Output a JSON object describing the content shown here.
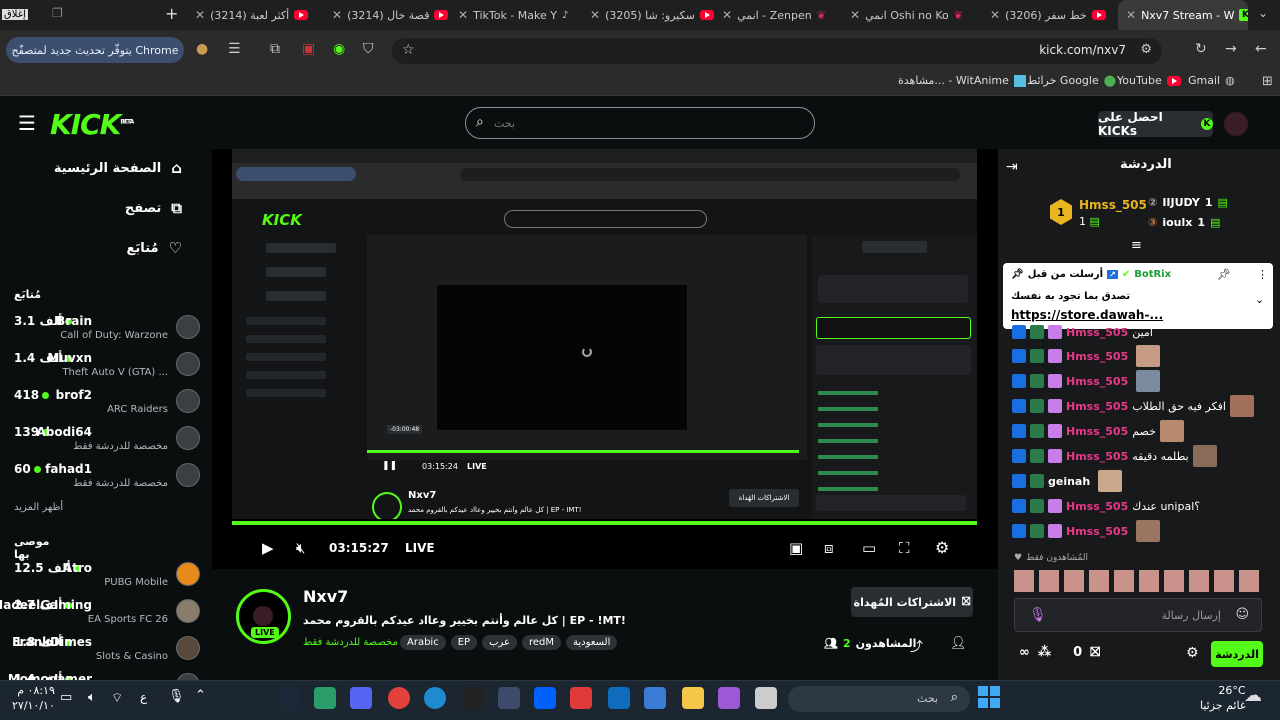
{
  "browser": {
    "tabs": [
      {
        "label": "أكثر لعبة (3214)",
        "icon": "youtube-icon"
      },
      {
        "label": "قصة خال (3214)",
        "icon": "youtube-icon"
      },
      {
        "label": "TikTok - Make Y",
        "icon": "tiktok-icon"
      },
      {
        "label": "سكيرو: شا (3205)",
        "icon": "youtube-icon"
      },
      {
        "label": "انمي - Zenpen",
        "icon": "witanime-icon"
      },
      {
        "label": "انمي Oshi no Ko",
        "icon": "witanime-icon"
      },
      {
        "label": "خط سفر (3206)",
        "icon": "youtube-icon"
      },
      {
        "label": "Nxv7 Stream - W",
        "icon": "kick-icon"
      }
    ],
    "close_button_label": "إغلاق",
    "url": "kick.com/nxv7",
    "update_label": "يتوفّر تحديث جديد لمتصفّح Chrome",
    "bookmarks": [
      {
        "label": "Gmail",
        "icon": "gmail-icon"
      },
      {
        "label": "YouTube",
        "icon": "youtube-icon"
      },
      {
        "label": "خرائط Google",
        "icon": "maps-icon"
      },
      {
        "label": "مشاهدة... - WitAnime",
        "icon": "witanime-icon"
      }
    ]
  },
  "kick": {
    "logo": "KICK",
    "beta": "BETA",
    "search_placeholder": "بحث",
    "get_kicks_label": "احصل على KICKs"
  },
  "sidebar": {
    "nav": [
      {
        "label": "الصفحة الرئيسية",
        "icon": "home-icon"
      },
      {
        "label": "تصفح",
        "icon": "browse-icon"
      },
      {
        "label": "مُتابَع",
        "icon": "heart-icon"
      }
    ],
    "following_title": "مُتابَع",
    "following": [
      {
        "name": "Brain",
        "sub": "Call of Duty: Warzone",
        "count": "3.1 ألف"
      },
      {
        "name": "Muvxn",
        "sub": "Theft Auto V (GTA) ...",
        "count": "1.4 ألف"
      },
      {
        "name": "brof2",
        "sub": "ARC Raiders",
        "count": "418"
      },
      {
        "name": "Abodi64",
        "sub": "مخصصة للدردشة فقط",
        "count": "139"
      },
      {
        "name": "fahad1",
        "sub": "مخصصة للدردشة فقط",
        "count": "60"
      }
    ],
    "show_more": "أظهر المزيد",
    "recommended_title": "موصى بها",
    "recommended": [
      {
        "name": "Atro",
        "sub": "PUBG Mobile",
        "count": "12.5 ألف"
      },
      {
        "name": "HadeelGaming",
        "sub": "EA Sports FC 26",
        "count": "2.7 ألف"
      },
      {
        "name": "FrankDimes",
        "sub": "Slots & Casino",
        "count": "1.8 ألف"
      },
      {
        "name": "Momogamer",
        "sub": "",
        "count": "1.4 ألف"
      }
    ]
  },
  "player": {
    "elapsed": "03:15:27",
    "live_label": "LIVE",
    "progress": 1.0,
    "inner": {
      "elapsed": "03:15:24",
      "seek_tooltip": "-03:00:48",
      "channel": "Nxv7",
      "subs_label": "الاشتراكات الهُداة",
      "title": "كل عالم وأنتم بخيير وعااد عيدكم بالقروم محمد | EP - IMT!"
    }
  },
  "channel": {
    "name": "Nxv7",
    "live_badge": "LIVE",
    "title": "كل عالم وأنتم بخيير وعااد عيدكم بالقروم محمد | EP - !MT!",
    "category": "مخصصة للدردشة فقط",
    "tags": [
      "Arabic",
      "EP",
      "عرب",
      "redM",
      "السعودية"
    ],
    "gift_subs_label": "الاشتراكات المُهداة",
    "viewers_label": "المشاهدون",
    "viewers_count": "2"
  },
  "chat": {
    "title": "الدردشة",
    "leaderboard": [
      {
        "name": "Hmss_505",
        "value": "1"
      },
      {
        "name": "IIJUDY",
        "value": "1"
      },
      {
        "name": "ioulx",
        "value": "1"
      }
    ],
    "pinned": {
      "label": "أرسلت من قبل",
      "author": "BotRix",
      "message": "تصدق بما تجود به نفسك",
      "link": "https://store.dawah-..."
    },
    "messages": [
      {
        "user": "Hmss_505",
        "text": "آمين"
      },
      {
        "user": "Hmss_505",
        "text": ""
      },
      {
        "user": "Hmss_505",
        "text": ""
      },
      {
        "user": "Hmss_505",
        "text": "افكر فيه حق الطلاب"
      },
      {
        "user": "Hmss_505",
        "text": "خصم"
      },
      {
        "user": "Hmss_505",
        "text": "بطلمه دقيقه"
      },
      {
        "user": "geinah",
        "text": ""
      },
      {
        "user": "Hmss_505",
        "text": "عندك unipal؟"
      },
      {
        "user": "Hmss_505",
        "text": ""
      }
    ],
    "viewers_only_label": "المُشاهدون فقط",
    "input_placeholder": "إرسال رسالة",
    "send_label": "الدردشة",
    "kicks_count": "0",
    "infinity": "∞"
  },
  "taskbar": {
    "search_placeholder": "بحث",
    "weather_temp": "26°C",
    "weather_desc": "غائم جزئيا",
    "time": "٠٨:١٩ م",
    "date": "٢٧/١٠/١٠",
    "lang": "ع"
  },
  "colors": {
    "accent": "#53fc18",
    "chat_name": "#e8388a",
    "bg": "#0b0e0f"
  }
}
